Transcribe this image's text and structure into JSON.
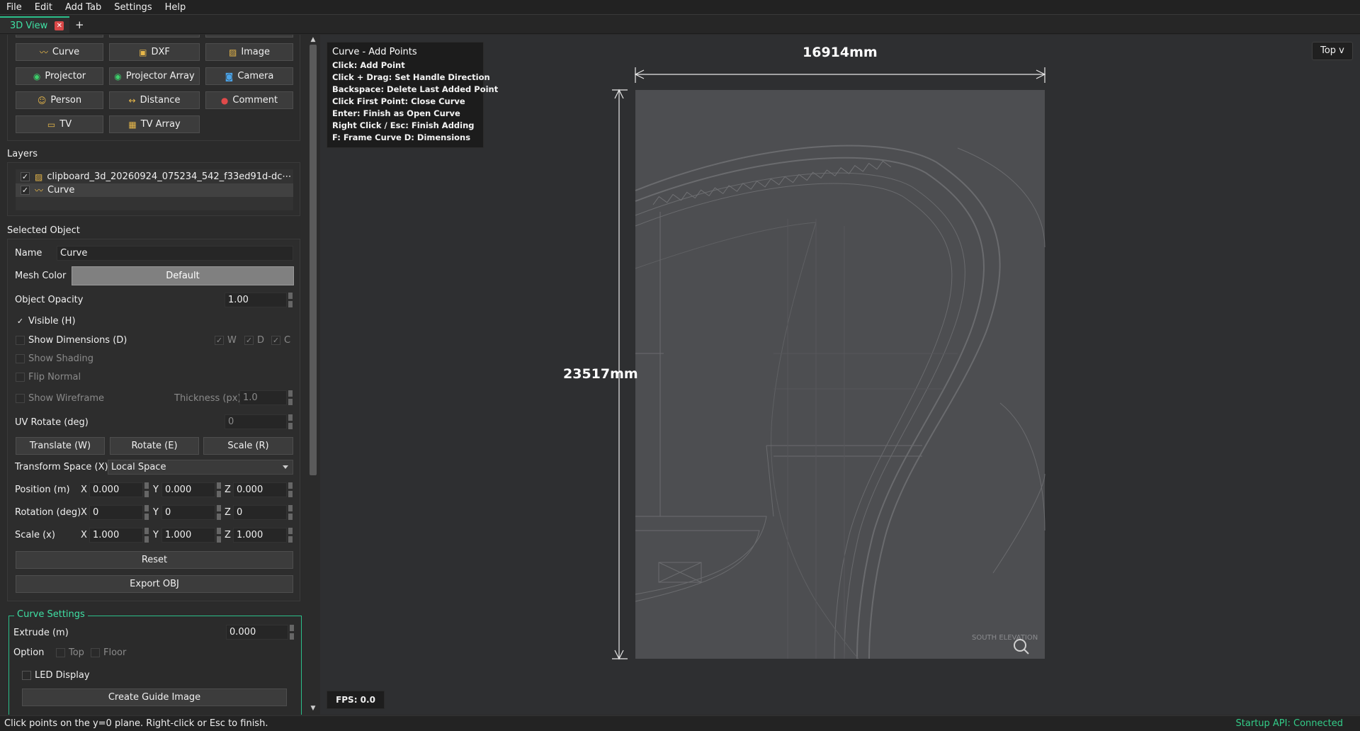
{
  "menu": [
    "File",
    "Edit",
    "Add Tab",
    "Settings",
    "Help"
  ],
  "tabs": {
    "active": "3D View",
    "add": "+"
  },
  "toolbar": {
    "curve": "Curve",
    "dxf": "DXF",
    "image": "Image",
    "projector": "Projector",
    "projector_array": "Projector Array",
    "camera": "Camera",
    "person": "Person",
    "distance": "Distance",
    "comment": "Comment",
    "tv": "TV",
    "tv_array": "TV Array"
  },
  "layers": {
    "title": "Layers",
    "items": [
      {
        "label": "clipboard_3d_20260924_075234_542_f33ed91d-dc⋯",
        "checked": true
      },
      {
        "label": "Curve",
        "checked": true
      }
    ]
  },
  "selected": {
    "title": "Selected Object",
    "name_label": "Name",
    "name_value": "Curve",
    "mesh_color_label": "Mesh Color",
    "mesh_color_value": "Default",
    "opacity_label": "Object Opacity",
    "opacity_value": "1.00",
    "visible": "Visible (H)",
    "show_dimensions": "Show Dimensions (D)",
    "dim_w": "W",
    "dim_d": "D",
    "dim_c": "C",
    "show_shading": "Show Shading",
    "flip_normal": "Flip Normal",
    "show_wireframe": "Show Wireframe",
    "thickness_label": "Thickness (px)",
    "thickness_value": "1.0",
    "uv_rotate_label": "UV Rotate (deg)",
    "uv_rotate_value": "0",
    "translate": "Translate (W)",
    "rotate": "Rotate (E)",
    "scale": "Scale (R)",
    "transform_space_label": "Transform Space (X)",
    "transform_space_value": "Local Space",
    "position_label": "Position (m)",
    "rotation_label": "Rotation (deg)",
    "scale_label": "Scale (x)",
    "axis_x": "X",
    "axis_y": "Y",
    "axis_z": "Z",
    "position": {
      "x": "0.000",
      "y": "0.000",
      "z": "0.000"
    },
    "rotation": {
      "x": "0",
      "y": "0",
      "z": "0"
    },
    "scale_xyz": {
      "x": "1.000",
      "y": "1.000",
      "z": "1.000"
    },
    "reset": "Reset",
    "export": "Export OBJ"
  },
  "curve_settings": {
    "title": "Curve Settings",
    "extrude_label": "Extrude (m)",
    "extrude_value": "0.000",
    "option_label": "Option",
    "top": "Top",
    "floor": "Floor",
    "led_display": "LED Display",
    "create_guide": "Create Guide Image"
  },
  "viewport": {
    "help_title": "Curve - Add Points",
    "help_lines": [
      "Click: Add Point",
      "Click + Drag: Set Handle Direction",
      "Backspace: Delete Last Added Point",
      "Click First Point: Close Curve",
      "Enter: Finish as Open Curve",
      "Right Click / Esc: Finish Adding",
      "F: Frame Curve   D: Dimensions"
    ],
    "width_dim": "16914mm",
    "height_dim": "23517mm",
    "view_mode": "Top v",
    "fps": "FPS: 0.0",
    "drawing_caption": "SOUTH ELEVATION"
  },
  "status": {
    "left": "Click points on the y=0 plane. Right-click or Esc to finish.",
    "right": "Startup API: Connected"
  },
  "colors": {
    "accent": "#2bbf8a",
    "status_ok": "#33cc88",
    "close_red": "#d94848"
  }
}
